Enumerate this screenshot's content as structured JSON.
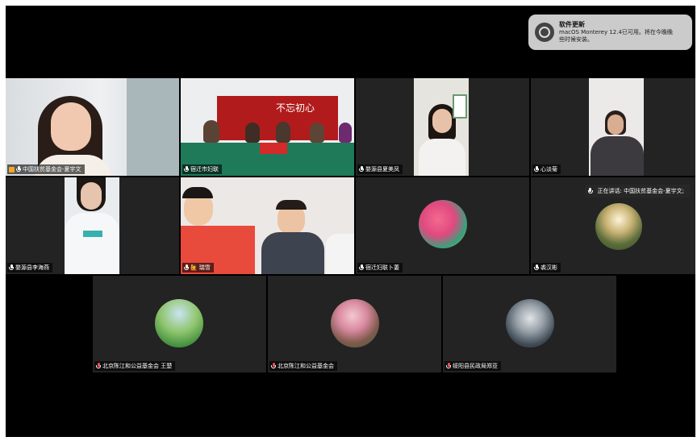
{
  "notification": {
    "title": "软件更新",
    "body_line1": "macOS Monterey 12.4已可用。将在今晚晚",
    "body_line2": "些时候安装。",
    "icon": "software-update-icon"
  },
  "speaking_indicator": {
    "text": "正在讲话: 中国扶贫基金会-夏宇文;",
    "icon": "microphone-icon"
  },
  "participants": [
    {
      "name": "中国扶贫基金会-夏宇文",
      "mic": "on",
      "hand": true,
      "active": true
    },
    {
      "name": "宿迁市妇联",
      "mic": "on",
      "hand": false,
      "active": false
    },
    {
      "name": "婺源县夏美凤",
      "mic": "on",
      "hand": false,
      "active": false
    },
    {
      "name": "心淡菊",
      "mic": "on",
      "hand": false,
      "active": false
    },
    {
      "name": "婺源县李海燕",
      "mic": "on",
      "hand": false,
      "active": false
    },
    {
      "name": "瑞雪",
      "mic": "on",
      "hand": false,
      "active": false,
      "emoji": "🙋"
    },
    {
      "name": "宿迁妇联卜萋",
      "mic": "on",
      "hand": false,
      "active": false
    },
    {
      "name": "裘汉彬",
      "mic": "on",
      "hand": false,
      "active": false
    },
    {
      "name": "北京陈江和公益基金会 王楚",
      "mic": "muted",
      "hand": false,
      "active": false
    },
    {
      "name": "北京陈江和公益基金会",
      "mic": "muted",
      "hand": false,
      "active": false
    },
    {
      "name": "绥阳县民政局郑亚",
      "mic": "muted",
      "hand": false,
      "active": false
    }
  ],
  "tile_banner_text": "不忘初心"
}
